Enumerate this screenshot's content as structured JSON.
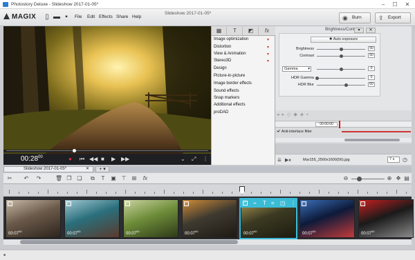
{
  "window": {
    "title": "Photostory Deluxe - Slideshow 2017-01-05*"
  },
  "app": {
    "logo": "MAGIX"
  },
  "menu": [
    "File",
    "Edit",
    "Effects",
    "Share",
    "Help"
  ],
  "header": {
    "document_title": "Slideshow 2017-01-05*",
    "burn_label": "Burn",
    "export_label": "Export"
  },
  "preview": {
    "timecode": "00:28",
    "timecode_frames": "00"
  },
  "effects_list": [
    "Image optimization",
    "Distortion",
    "View & Animation",
    "Stereo3D",
    "Design",
    "Picture-in-picture",
    "Image border effects",
    "Sound effects",
    "Snap markers",
    "Additional effects",
    "proDAD"
  ],
  "effects_tabs": [
    "grid",
    "T",
    "◩",
    "fx"
  ],
  "panel": {
    "title": "Brightness/Contrast",
    "auto_button": "Auto exposure",
    "brightness_label": "Brightness",
    "brightness_value": "50",
    "brightness_level": 0.5,
    "contrast_label": "Contrast",
    "contrast_value": "50",
    "contrast_level": 0.5,
    "gamma_select": "Gamma",
    "gamma_value": "0",
    "gamma_level": 0.5,
    "hdr_gamma_label": "HDR Gamma",
    "hdr_gamma_value": "0",
    "hdr_gamma_level": 0.0,
    "hdr_blur_label": "HDR Blur",
    "hdr_blur_value": "60",
    "hdr_blur_level": 0.6
  },
  "timeline": {
    "current_time": "00:00:00",
    "anti_interlace": "Anti-interlace filter",
    "file_name": "Mar155_2560x1600(56).jpg",
    "duration_field": "7 s",
    "tab_label": "Slideshow 2017-01-05*"
  },
  "thumbnails": [
    {
      "duration": "00:07",
      "frames": "00",
      "colors": [
        "#6b5a4a",
        "#c6b8a5",
        "#2d241c"
      ]
    },
    {
      "duration": "00:07",
      "frames": "00",
      "colors": [
        "#2a6f7c",
        "#9fc7d1",
        "#5a3a2c"
      ]
    },
    {
      "duration": "00:07",
      "frames": "00",
      "colors": [
        "#6f8e3a",
        "#c9d2a0",
        "#2e3a18"
      ]
    },
    {
      "duration": "00:07",
      "frames": "00",
      "colors": [
        "#3e3a30",
        "#d08b38",
        "#1e1a14"
      ]
    },
    {
      "duration": "00:07",
      "frames": "00",
      "colors": [
        "#3c3a22",
        "#b09a55",
        "#1d1c10"
      ]
    },
    {
      "duration": "00:07",
      "frames": "00",
      "colors": [
        "#0d1a3a",
        "#3a6fb8",
        "#c23a3a"
      ]
    },
    {
      "duration": "00:07",
      "frames": "00",
      "colors": [
        "#1a1a1a",
        "#c81f1f",
        "#8a8a8a"
      ]
    }
  ],
  "colors": {
    "accent": "#3bbcd6",
    "preview_bg": "#1e1f22"
  }
}
